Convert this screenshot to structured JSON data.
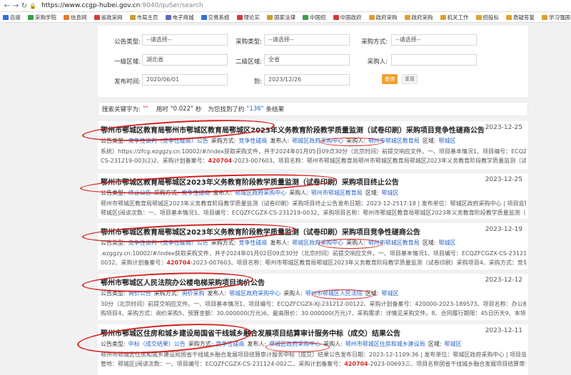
{
  "browser": {
    "url_host": "https://www.ccgp-hubei.gov.cn",
    "url_path": ":9040/quSer/search",
    "bookmarks": [
      "百度",
      "采购学院",
      "信息网",
      "省政采网",
      "市局主页",
      "电子商城",
      "交易系统",
      "理论实",
      "国家法律",
      "中国招",
      "中国政府",
      "政府采购",
      "政府采购",
      "机关工作",
      "招投标",
      "质疑答复",
      "学习强国",
      "国库司",
      "学习"
    ]
  },
  "search": {
    "notice_type_label": "公告类型:",
    "notice_type_value": "--请选择--",
    "purchase_type_label": "采购类型:",
    "purchase_type_value": "--请选择--",
    "purchase_method_label": "采购方式:",
    "purchase_method_value": "--请选择--",
    "region1_label": "一级区域:",
    "region1_value": "湖北省",
    "region2_label": "二级区域:",
    "region2_value": "全省",
    "purchaser_label": "采购人:",
    "publish_time_label": "发布时间:",
    "date_from": "2020/06/01",
    "to_label": "到:",
    "date_to": "2023/12/26",
    "search_btn": "查询",
    "reset_btn": "重置"
  },
  "summary": {
    "keyword_label": "搜索关键字为:",
    "keyword": "\"\"",
    "time_label": "用时",
    "time_value": "\"0.022\"",
    "time_unit": "秒",
    "found_prefix": "为您找到了约",
    "found_count": "\"136\"",
    "found_suffix": "条结果"
  },
  "results": [
    {
      "title": "鄂州市鄂城区教育局鄂州市鄂城区教育局鄂城区2023年义务教育阶段教学质量监测（试卷印刷）采购项目竞争性磋商公告",
      "date": "2023-12-25",
      "meta_type_label": "公告类型:",
      "meta_type": "竞争性谈判（竞争性磋商）公告",
      "meta_method_label": "采购方式:",
      "meta_method": "竞争性磋商",
      "meta_pub_label": "发布人:",
      "meta_pub": "鄂城区政府采购中心",
      "meta_buyer_label": "采购人:",
      "meta_buyer": "鄂州市鄂城区教育局",
      "meta_region_label": "区域:",
      "meta_region": "鄂城区",
      "body1": "系统）https://zfcg.ezggzy.cn:10002/#/index获取采购文件，并于2024年01月05日09点30分（北京时间）前提交响应文件。一、项目基本情况1、项目编号：ECQZFCGZX-",
      "body2a": "CS-231219-003(2)2、采购计划备案号：",
      "body2_hl": "420704",
      "body2b": "-2023-007603、项目名称：鄂州市鄂城区教育局鄂州市鄂城区教育局鄂城区2023年义务教育阶段教学质量监测（试卷印刷）采购项目4、采购方"
    },
    {
      "title": "鄂州市鄂城区教育局鄂城区2023年义务教育阶段教学质量监测（试卷印刷）采购项目终止公告",
      "date": "2023-12-25",
      "meta_type_label": "公告类型:",
      "meta_type": "终止公告",
      "meta_method_label": "采购方式:",
      "meta_method": "竞争性磋商",
      "meta_pub_label": "发布人:",
      "meta_pub": "鄂城区政府采购中心",
      "meta_buyer_label": "采购人:",
      "meta_buyer": "鄂州市鄂城区教育局",
      "meta_region_label": "区域:",
      "meta_region": "鄂城区",
      "body1": "鄂州市鄂城区教育局鄂城区2023年义务教育阶段教学质量监测（试卷印刷）采购项目终止公告发布日期：2023-12-2517:18 | 发布单位：鄂城区政府采购中心 | 项目监管地：",
      "body2a": "鄂城区|阅读次数：一、项目基本情况1、项目编号：ECQZFCGZX-CS-231219-0032、采购项目名称：鄂州市鄂城区教育局鄂城区2023年义务教育阶段教学质量监测（试卷印刷）采购项目",
      "body2_hl": "",
      "body2b": ""
    },
    {
      "title": "鄂州市鄂城区教育局鄂城区2023年义务教育阶段教学质量监测（试卷印刷）采购项目竞争性磋商公告",
      "date": "2023-12-19",
      "meta_type_label": "公告类型:",
      "meta_type": "竞争性谈判（竞争性磋商）公告",
      "meta_method_label": "采购方式:",
      "meta_method": "竞争性磋商",
      "meta_pub_label": "发布人:",
      "meta_pub": "鄂城区政府采购中心",
      "meta_buyer_label": "采购人:",
      "meta_buyer": "鄂州市鄂城区教育局",
      "meta_region_label": "区域:",
      "meta_region": "鄂城区",
      "body1": ".ezggzy.cn:10002/#/index获取采购文件，并于2024年01月02日09点30分（北京时间）前提交响应文件。一、项目基本情况1、项目编号：ECQZFCGZX-CS-231219-",
      "body2a": "0032、采购计划备案号：",
      "body2_hl": "420704",
      "body2b": "-2023-007603、项目名称：鄂州市鄂城区教育局鄂城区2023年义务教育阶段教学质量监测（试卷印刷）采购项目4、采购方式：竞争性磋商5、预算金额："
    },
    {
      "title": "鄂州市鄂城区人民法院办公楼电梯采购项目询价公告",
      "date": "2023-12-12",
      "meta_type_label": "公告类型:",
      "meta_type": "询价公告",
      "meta_method_label": "采购方式:",
      "meta_method": "询价采购",
      "meta_pub_label": "发布人:",
      "meta_pub": "鄂城区政府采购中心",
      "meta_buyer_label": "采购人:",
      "meta_buyer": "鄂州市鄂城区人民法院",
      "meta_region_label": "区域:",
      "meta_region": "鄂城区",
      "body1": "30分（北京时间）前提交响应文件。一、项目基本情况1、项目编号：ECQZFCGZX-XJ-231212-00122、采购计划备案号：420000-2023-189573、项目名称：办公楼电梯采",
      "body2a": "购项目4、采购方式：询价采购5、预算金额：30.000000(万元)6、最高限价：30.000000(万元)7、采购需求：详情见采购文件。8、合同履行期限：45日历天9、本项目（是/",
      "body2_hl": "",
      "body2b": ""
    },
    {
      "title": "鄂州市鄂城区住房和城乡建设局国省干线城乡融合发展项目结算审计服务中标（成交）结果公告",
      "date": "2023-12-11",
      "meta_type_label": "公告类型:",
      "meta_type": "中标（成交结果）公告",
      "meta_method_label": "采购方式:",
      "meta_method": "竞争性磋商",
      "meta_pub_label": "发布人:",
      "meta_pub": "鄂城区政府采购中心",
      "meta_buyer_label": "采购人:",
      "meta_buyer": "鄂州市鄂城区住房和城乡建设局",
      "meta_region_label": "区域:",
      "meta_region": "鄂城区",
      "body1": "鄂州市鄂城区住房和城乡建设局国省干线城乡融合发展项目结算审计服务中标（成交）结果公告发布日期：2023-12-1109:36 | 发布单位：鄂城区政府采购中心 | 项目监",
      "body2a": "管地：鄂城区|阅读次数：一、项目编号：ECQZFCGZX-CS-231124-002二、采购计划备案号：",
      "body2_hl": "420704",
      "body2b": "-2023-00693三、项目名称国省干线城乡融合发展项目结算审计服务四、中"
    }
  ],
  "colors": {
    "accent": "#f0a030",
    "link": "#2a64c5",
    "highlight": "#d62b2b",
    "annotation": "#d42020"
  }
}
